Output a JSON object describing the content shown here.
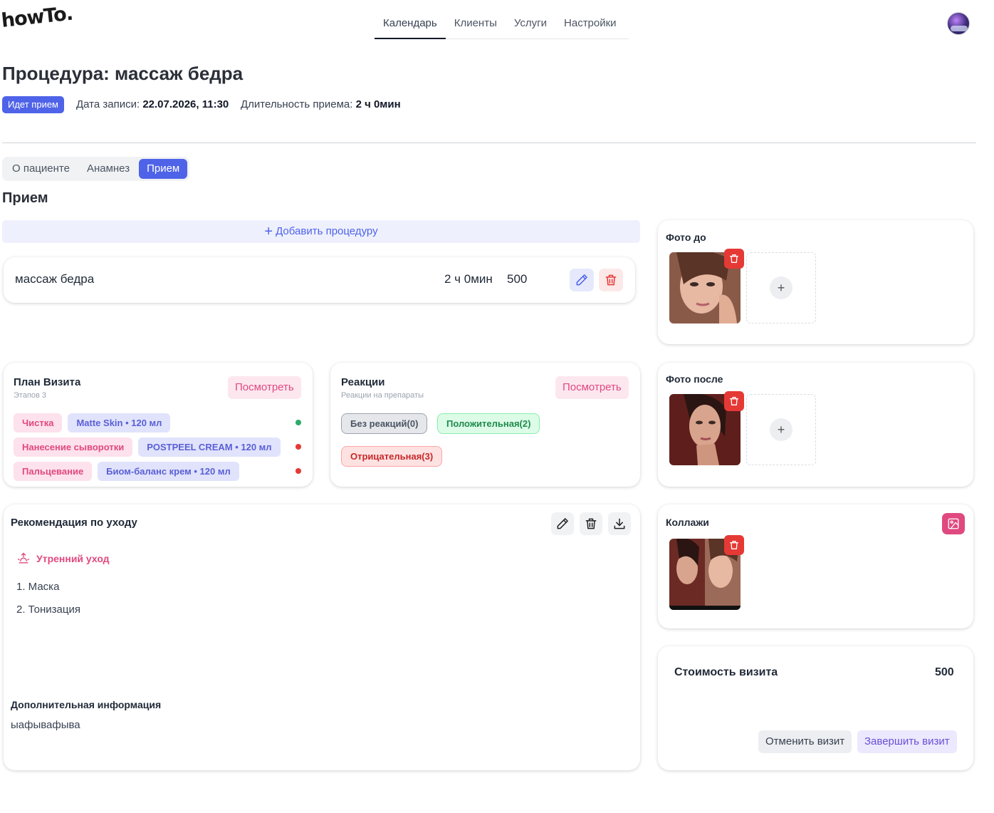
{
  "app": {
    "logo": "howTo."
  },
  "nav": {
    "items": [
      "Календарь",
      "Клиенты",
      "Услуги",
      "Настройки"
    ],
    "active": "Календарь"
  },
  "page": {
    "title": "Процедура: массаж бедра",
    "status": "Идет прием",
    "date_label": "Дата записи:",
    "date_value": "22.07.2026, 11:30",
    "duration_label": "Длительность приема:",
    "duration_value": "2 ч 0мин"
  },
  "tabs": [
    "О пациенте",
    "Анамнез",
    "Прием"
  ],
  "active_tab": "Прием",
  "section_title": "Прием",
  "add_procedure": "Добавить процедуру",
  "procedure": {
    "name": "массаж бедра",
    "duration": "2 ч 0мин",
    "price": "500"
  },
  "plan": {
    "title": "План Визита",
    "subtitle": "Этапов 3",
    "view": "Посмотреть",
    "rows": [
      {
        "step": "Чистка",
        "product": "Matte Skin • 120 мл",
        "status_color": "#2eaa6a"
      },
      {
        "step": "Нанесение сыворотки",
        "product": "POSTPEEL CREAM • 120 мл",
        "status_color": "#e53935"
      },
      {
        "step": "Пальцевание",
        "product": "Биом-баланс крем • 120 мл",
        "status_color": "#e53935"
      }
    ]
  },
  "reactions": {
    "title": "Реакции",
    "subtitle": "Реакции на препараты",
    "view": "Посмотреть",
    "none": "Без реакций(0)",
    "positive": "Положительная(2)",
    "negative": "Отрицательная(3)"
  },
  "care": {
    "title": "Рекомендация по уходу",
    "morning_title": "Утренний уход",
    "items": [
      "1. Маска",
      "2. Тонизация"
    ],
    "extra_title": "Дополнительная информация",
    "extra_text": "ыафывафыва"
  },
  "photos_before": {
    "title": "Фото до"
  },
  "photos_after": {
    "title": "Фото после"
  },
  "collages": {
    "title": "Коллажи"
  },
  "cost": {
    "label": "Стоимость визита",
    "value": "500",
    "cancel": "Отменить визит",
    "finish": "Завершить визит"
  },
  "colors": {
    "accent": "#4f63e8",
    "pink": "#e0497f",
    "danger": "#e53935"
  }
}
